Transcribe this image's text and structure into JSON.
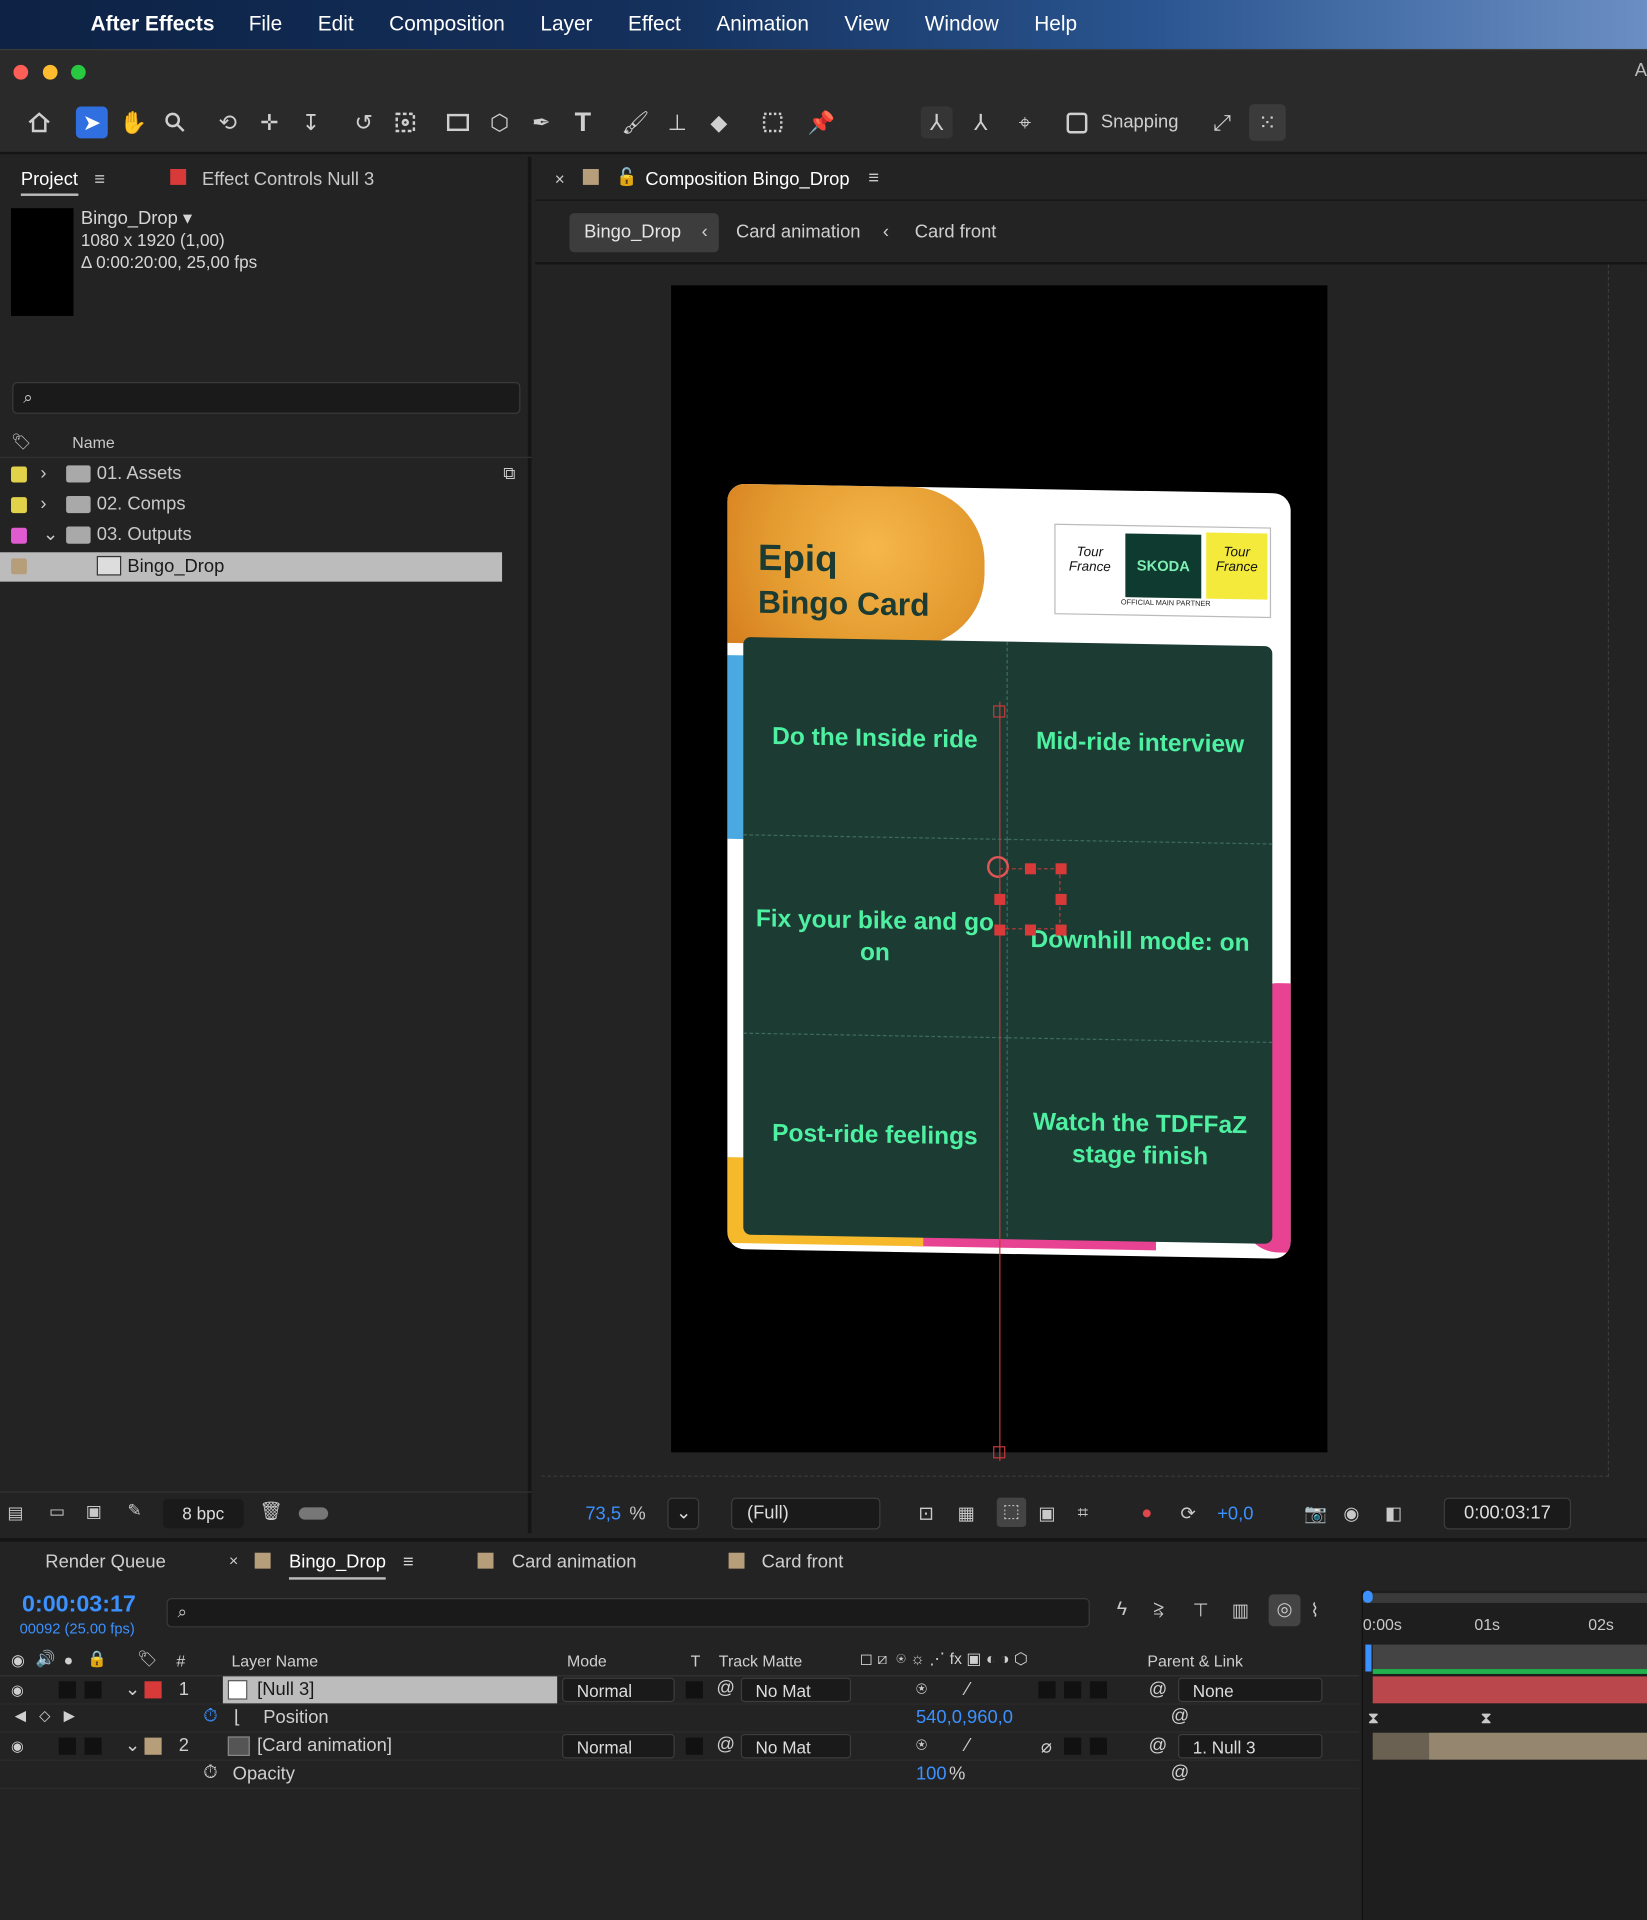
{
  "menubar": {
    "app_name": "After Effects",
    "items": [
      "File",
      "Edit",
      "Composition",
      "Layer",
      "Effect",
      "Animation",
      "View",
      "Window",
      "Help"
    ]
  },
  "titlebar": {
    "title_fragment": "A"
  },
  "toolbar": {
    "snapping_label": "Snapping"
  },
  "project": {
    "tab_project": "Project",
    "tab_effect_controls": "Effect Controls Null 3",
    "selected_name": "Bingo_Drop ▾",
    "selected_size": "1080 x 1920 (1,00)",
    "selected_duration": "Δ 0:00:20:00, 25,00 fps",
    "col_name": "Name",
    "items": [
      {
        "label": "01. Assets",
        "color": "#e2d24a"
      },
      {
        "label": "02. Comps",
        "color": "#e2d24a"
      },
      {
        "label": "03. Outputs",
        "color": "#e05ad0"
      },
      {
        "label": "Bingo_Drop",
        "color": "#b79e7a"
      }
    ],
    "bpc": "8 bpc"
  },
  "composition": {
    "tab_label": "Composition Bingo_Drop",
    "breadcrumbs": [
      "Bingo_Drop",
      "Card animation",
      "Card front"
    ],
    "card": {
      "title_line1": "Epiq",
      "title_line2": "Bingo Card",
      "sponsor": "SKODA",
      "sponsor_sub": "OFFICIAL MAIN PARTNER",
      "cells": [
        "Do the Inside ride",
        "Mid-ride interview",
        "Fix your bike and go on",
        "Downhill mode: on",
        "Post-ride feelings",
        "Watch the TDFFaZ stage finish"
      ]
    },
    "zoom": "73,5",
    "zoom_unit": "%",
    "resolution": "(Full)",
    "exposure": "+0,0",
    "timecode": "0:00:03:17"
  },
  "timeline": {
    "tab_render_queue": "Render Queue",
    "tab_bingo": "Bingo_Drop",
    "tab_card_animation": "Card animation",
    "tab_card_front": "Card front",
    "timecode": "0:00:03:17",
    "frames": "00092 (25.00 fps)",
    "headers": {
      "num": "#",
      "layer_name": "Layer Name",
      "mode": "Mode",
      "t": "T",
      "track_matte": "Track Matte",
      "parent": "Parent & Link"
    },
    "layers": [
      {
        "num": "1",
        "name": "[Null 3]",
        "mode": "Normal",
        "matte": "No Mat",
        "parent": "None",
        "label_color": "#d83a3a"
      },
      {
        "num": "2",
        "name": "[Card animation]",
        "mode": "Normal",
        "matte": "No Mat",
        "parent": "1. Null 3",
        "label_color": "#b79e7a"
      }
    ],
    "props": [
      {
        "name": "Position",
        "value": "540,0,960,0"
      },
      {
        "name": "Opacity",
        "value": "100",
        "unit": "%"
      }
    ],
    "ruler": [
      "0:00s",
      "01s",
      "02s"
    ]
  },
  "colors": {
    "accent_blue": "#2f6fe0",
    "timecode_blue": "#3b91ff",
    "card_green": "#1b3b33",
    "card_text_green": "#4ef0a2",
    "null_layer_red": "#d83a3a"
  }
}
